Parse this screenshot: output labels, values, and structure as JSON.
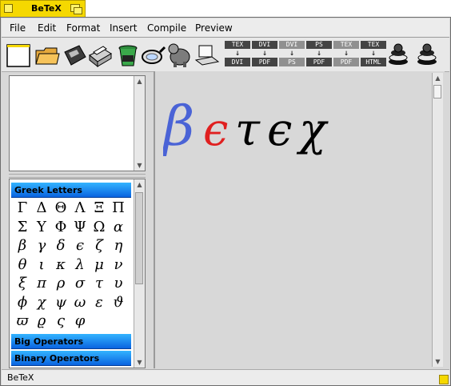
{
  "window": {
    "title": "BeTeX"
  },
  "menubar": {
    "items": [
      "File",
      "Edit",
      "Format",
      "Compile",
      "Insert",
      "Preview"
    ]
  },
  "toolbar": {
    "icons": [
      "new-document-icon",
      "open-folder-icon",
      "save-disk-icon",
      "print-icon",
      "trash-icon",
      "magnifier-icon",
      "mascot-icon",
      "laptop-icon"
    ],
    "conversions": [
      {
        "from": "TEX",
        "to": "DVI",
        "enabled": true
      },
      {
        "from": "DVI",
        "to": "PDF",
        "enabled": true
      },
      {
        "from": "DVI",
        "to": "PS",
        "enabled": false
      },
      {
        "from": "PS",
        "to": "PDF",
        "enabled": true
      },
      {
        "from": "TEX",
        "to": "PDF",
        "enabled": false
      },
      {
        "from": "TEX",
        "to": "HTML",
        "enabled": true
      }
    ]
  },
  "symbols": {
    "sections": {
      "greek": "Greek Letters",
      "big_operators": "Big Operators",
      "binary_operators": "Binary Operators"
    },
    "greek_letters": [
      [
        "Γ",
        "Δ",
        "Θ",
        "Λ",
        "Ξ",
        "Π"
      ],
      [
        "Σ",
        "Υ",
        "Φ",
        "Ψ",
        "Ω",
        "α"
      ],
      [
        "β",
        "γ",
        "δ",
        "ϵ",
        "ζ",
        "η"
      ],
      [
        "θ",
        "ι",
        "κ",
        "λ",
        "μ",
        "ν"
      ],
      [
        "ξ",
        "π",
        "ρ",
        "σ",
        "τ",
        "υ"
      ],
      [
        "ϕ",
        "χ",
        "ψ",
        "ω",
        "ε",
        "ϑ"
      ],
      [
        "ϖ",
        "ϱ",
        "ς",
        "φ"
      ]
    ]
  },
  "editor": {
    "logo_letters": [
      "β",
      "ϵ",
      "τ",
      "ϵ",
      "χ"
    ],
    "logo_colors": [
      "#4a63d6",
      "#e02020",
      "#000000",
      "#000000",
      "#000000"
    ]
  },
  "status": {
    "text": "BeTeX"
  },
  "colors": {
    "title_tab": "#f5d800",
    "section_header": "#1a8cff"
  }
}
